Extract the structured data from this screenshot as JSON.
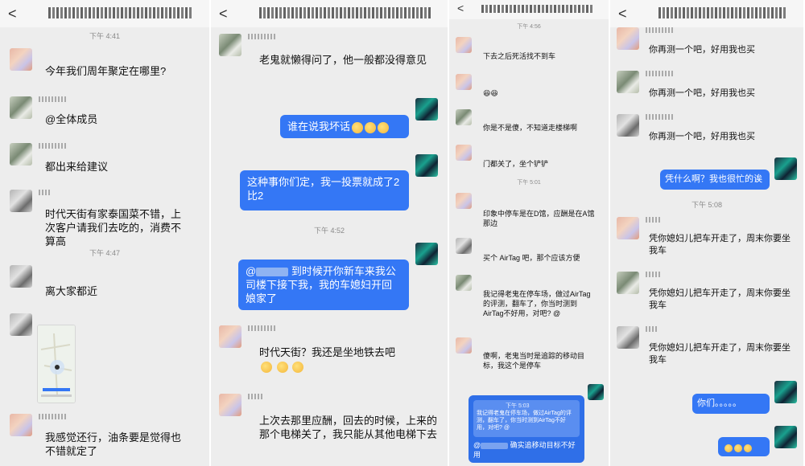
{
  "panel1": {
    "back": "<",
    "time1": "下午 4:41",
    "msg1": "今年我们周年聚定在哪里?",
    "msg2": "@全体成员",
    "msg3": "都出来给建议",
    "msg4": "时代天街有家泰国菜不错，上次客户请我们去吃的，消费不算高",
    "time2": "下午 4:47",
    "msg5": "离大家都近",
    "msg6": "我感觉还行，油条要是觉得也不错就定了"
  },
  "panel2": {
    "back": "<",
    "msg1": "老鬼就懒得问了，他一般都没得意见",
    "msg2": "谁在说我坏话",
    "msg3": "这种事你们定，我一投票就成了2比2",
    "time1": "下午 4:52",
    "msg4a": "@",
    "msg4b": "到时候开你新车来我公司楼下接下我，我的车媳妇开回娘家了",
    "msg5": "时代天街？我还是坐地铁去吧",
    "msg6": "上次去那里应酬，回去的时候，上来的那个电梯关了，我只能从其他电梯下去"
  },
  "panel3": {
    "back": "<",
    "time1": "下午 4:56",
    "msg1": "下去之后死活找不到车",
    "msg2": "😆😆",
    "msg3": "你是不是傻，不知道走楼梯啊",
    "msg4": "门都关了，坐个铲铲",
    "time2": "下午 5:01",
    "msg5": "印象中停车是在D馆，应酬是在A馆那边",
    "msg6": "买个 AirTag 吧，那个应该方便",
    "msg7": "我记得老鬼在停车场，做过AirTag的评测，翻车了，你当时测到AirTag不好用，对吧? @",
    "msg8": "傻啊，老鬼当时是追踪的移动目标，我这个是停车",
    "quote_time": "下午 5:03",
    "quote_text": "我记得老鬼在停车场，做过AirTag的评测，翻车了，你当时测到AirTag不好用，对吧? @",
    "reply_at": "@",
    "reply_text": "确实追移动目标不好用"
  },
  "panel4": {
    "back": "<",
    "msg1": "你再测一个吧，好用我也买",
    "msg2": "你再测一个吧，好用我也买",
    "msg3": "你再测一个吧，好用我也买",
    "msg4": "凭什么啊？我也很忙的诶",
    "time1": "下午 5:08",
    "msg5": "凭你媳妇儿把车开走了，周末你要坐我车",
    "msg6": "凭你媳妇儿把车开走了，周末你要坐我车",
    "msg7": "凭你媳妇儿把车开走了，周末你要坐我车",
    "msg8": "你们。。。。。"
  },
  "colors": {
    "my_bubble": "#3477f5",
    "background": "#ededed"
  }
}
